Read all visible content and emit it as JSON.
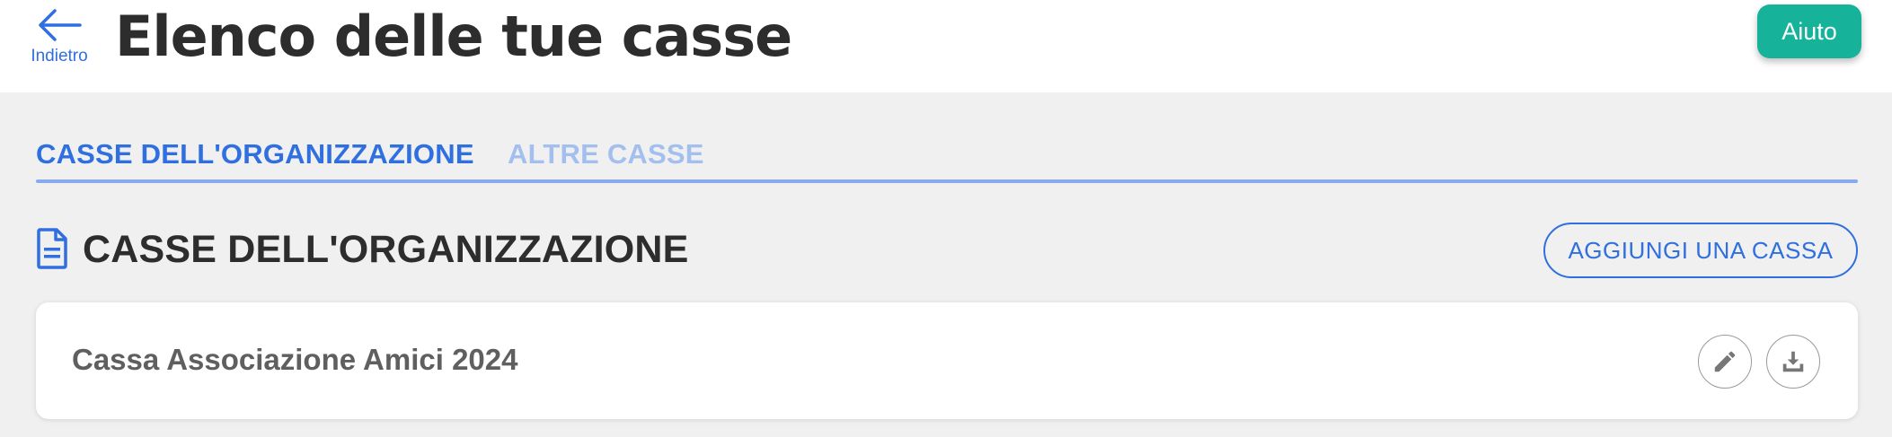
{
  "header": {
    "back_label": "Indietro",
    "title": "Elenco delle tue casse",
    "help_label": "Aiuto"
  },
  "tabs": [
    {
      "label": "CASSE DELL'ORGANIZZAZIONE",
      "active": true
    },
    {
      "label": "ALTRE CASSE",
      "active": false
    }
  ],
  "section": {
    "title": "CASSE DELL'ORGANIZZAZIONE",
    "icon": "document-icon",
    "add_label": "AGGIUNGI UNA CASSA"
  },
  "cash_registers": [
    {
      "name": "Cassa Associazione Amici 2024",
      "actions": [
        "pencil-icon",
        "download-icon"
      ]
    }
  ],
  "colors": {
    "accent": "#2f6fe0",
    "help_button": "#16b39a",
    "inactive_tab": "#a3bff0",
    "background": "#f0f0f0"
  }
}
